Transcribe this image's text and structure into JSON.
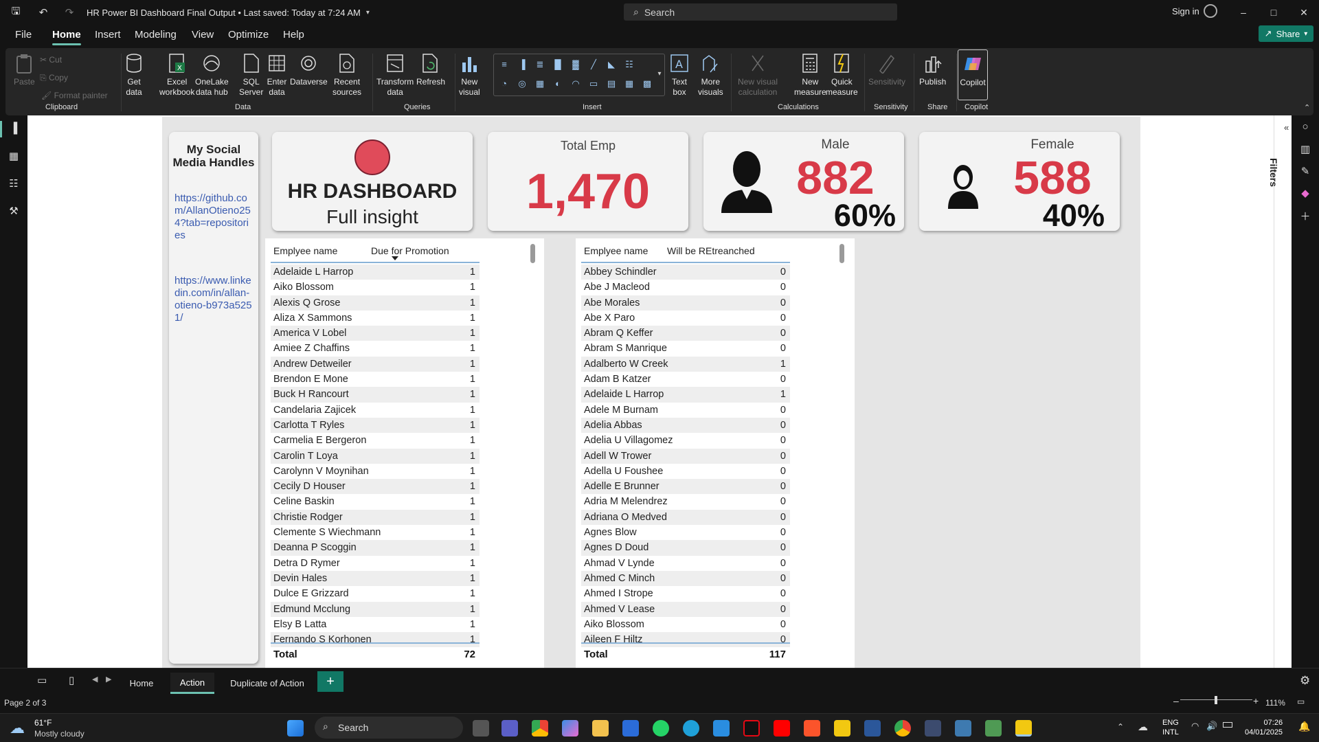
{
  "titlebar": {
    "doc_title": "HR Power BI Dashboard Final Output • Last saved: Today at 7:24 AM",
    "search_placeholder": "Search",
    "sign_in": "Sign in"
  },
  "menu": {
    "items": [
      "File",
      "Home",
      "Insert",
      "Modeling",
      "View",
      "Optimize",
      "Help"
    ],
    "active": "Home",
    "share": "Share"
  },
  "ribbon": {
    "clipboard": {
      "paste": "Paste",
      "cut": "Cut",
      "copy": "Copy",
      "format_painter": "Format painter",
      "group": "Clipboard"
    },
    "data": {
      "get_data": "Get\ndata",
      "excel": "Excel\nworkbook",
      "onelake": "OneLake\ndata hub",
      "sql": "SQL\nServer",
      "enter": "Enter\ndata",
      "dataverse": "Dataverse",
      "recent": "Recent\nsources",
      "group": "Data"
    },
    "queries": {
      "transform": "Transform\ndata",
      "refresh": "Refresh",
      "group": "Queries"
    },
    "insert": {
      "new_visual": "New\nvisual",
      "text_box": "Text\nbox",
      "more_visuals": "More\nvisuals",
      "group": "Insert"
    },
    "calculations": {
      "new_visual_calc": "New visual\ncalculation",
      "new_measure": "New\nmeasure",
      "quick_measure": "Quick\nmeasure",
      "group": "Calculations"
    },
    "sensitivity": {
      "label": "Sensitivity",
      "group": "Sensitivity"
    },
    "share": {
      "publish": "Publish",
      "group": "Share"
    },
    "copilot": {
      "label": "Copilot",
      "group": "Copilot"
    }
  },
  "filters_label": "Filters",
  "report": {
    "social": {
      "title": "My Social Media Handles",
      "github": "https://github.com/AllanOtieno254?tab=repositories",
      "linkedin": "https://www.linkedin.com/in/allan-otieno-b973a5251/"
    },
    "hr_card": {
      "title": "HR DASHBOARD",
      "subtitle": "Full insight",
      "dot_color": "#e04b5a"
    },
    "total_card": {
      "label": "Total Emp",
      "value": "1,470"
    },
    "male_card": {
      "label": "Male",
      "value": "882",
      "percent": "60%"
    },
    "female_card": {
      "label": "Female",
      "value": "588",
      "percent": "40%"
    },
    "promotion_table": {
      "col_name": "Emplyee name",
      "col_value": "Due for Promotion",
      "rows": [
        [
          "Adelaide L Harrop",
          "1"
        ],
        [
          "Aiko Blossom",
          "1"
        ],
        [
          "Alexis Q Grose",
          "1"
        ],
        [
          "Aliza X Sammons",
          "1"
        ],
        [
          "America V Lobel",
          "1"
        ],
        [
          "Amiee Z Chaffins",
          "1"
        ],
        [
          "Andrew Detweiler",
          "1"
        ],
        [
          "Brendon E Mone",
          "1"
        ],
        [
          "Buck H Rancourt",
          "1"
        ],
        [
          "Candelaria Zajicek",
          "1"
        ],
        [
          "Carlotta T Ryles",
          "1"
        ],
        [
          "Carmelia E Bergeron",
          "1"
        ],
        [
          "Carolin T Loya",
          "1"
        ],
        [
          "Carolynn V Moynihan",
          "1"
        ],
        [
          "Cecily D Houser",
          "1"
        ],
        [
          "Celine Baskin",
          "1"
        ],
        [
          "Christie Rodger",
          "1"
        ],
        [
          "Clemente S Wiechmann",
          "1"
        ],
        [
          "Deanna P Scoggin",
          "1"
        ],
        [
          "Detra D Rymer",
          "1"
        ],
        [
          "Devin Hales",
          "1"
        ],
        [
          "Dulce E Grizzard",
          "1"
        ],
        [
          "Edmund Mcclung",
          "1"
        ],
        [
          "Elsy B Latta",
          "1"
        ],
        [
          "Fernando S Korhonen",
          "1"
        ]
      ],
      "total_label": "Total",
      "total_value": "72"
    },
    "retrench_table": {
      "col_name": "Emplyee name",
      "col_value": "Will be REtreanched",
      "rows": [
        [
          "Abbey Schindler",
          "0"
        ],
        [
          "Abe J Macleod",
          "0"
        ],
        [
          "Abe Morales",
          "0"
        ],
        [
          "Abe X Paro",
          "0"
        ],
        [
          "Abram Q Keffer",
          "0"
        ],
        [
          "Abram S Manrique",
          "0"
        ],
        [
          "Adalberto W Creek",
          "1"
        ],
        [
          "Adam B Katzer",
          "0"
        ],
        [
          "Adelaide L Harrop",
          "1"
        ],
        [
          "Adele M Burnam",
          "0"
        ],
        [
          "Adelia Abbas",
          "0"
        ],
        [
          "Adelia U Villagomez",
          "0"
        ],
        [
          "Adell W Trower",
          "0"
        ],
        [
          "Adella U Foushee",
          "0"
        ],
        [
          "Adelle E Brunner",
          "0"
        ],
        [
          "Adria M Melendrez",
          "0"
        ],
        [
          "Adriana O Medved",
          "0"
        ],
        [
          "Agnes Blow",
          "0"
        ],
        [
          "Agnes D Doud",
          "0"
        ],
        [
          "Ahmad V Lynde",
          "0"
        ],
        [
          "Ahmed C Minch",
          "0"
        ],
        [
          "Ahmed I Strope",
          "0"
        ],
        [
          "Ahmed V Lease",
          "0"
        ],
        [
          "Aiko Blossom",
          "0"
        ],
        [
          "Aileen F Hiltz",
          "0"
        ]
      ],
      "total_label": "Total",
      "total_value": "117"
    }
  },
  "page_tabs": {
    "tabs": [
      "Home",
      "Action",
      "Duplicate of Action"
    ],
    "active": "Action"
  },
  "status": {
    "page_indicator": "Page 2 of 3",
    "zoom": "111%"
  },
  "taskbar": {
    "weather_temp": "61°F",
    "weather_desc": "Mostly cloudy",
    "search": "Search",
    "lang_1": "ENG",
    "lang_2": "INTL",
    "time": "07:26",
    "date": "04/01/2025"
  }
}
